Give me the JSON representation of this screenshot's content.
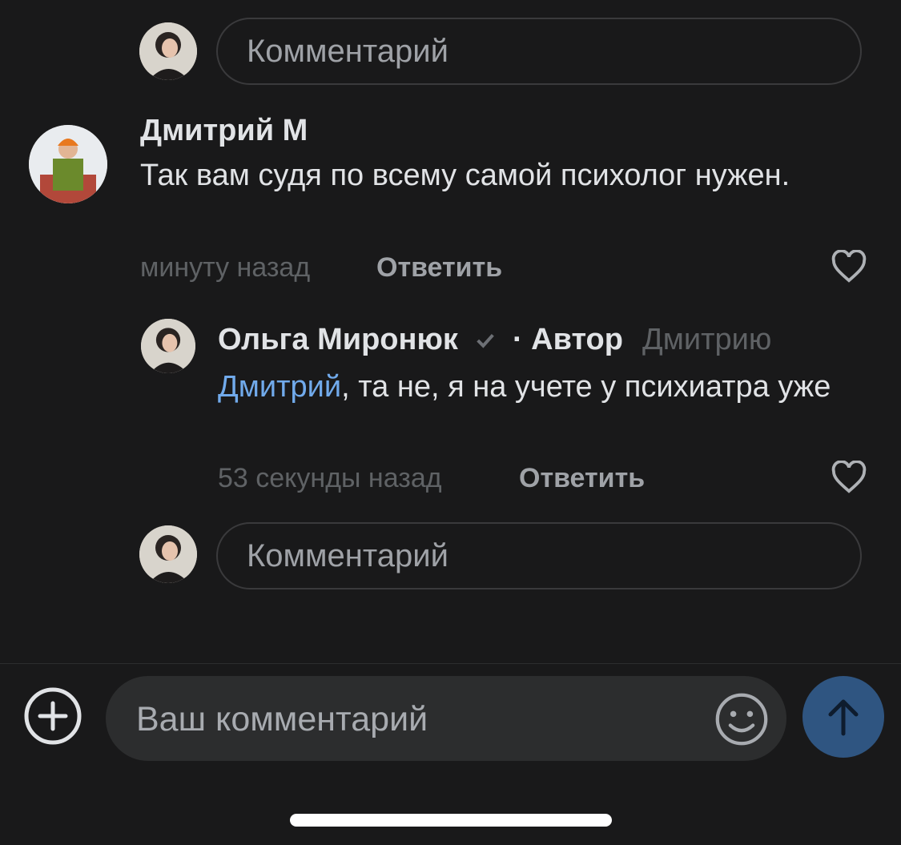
{
  "top_composer": {
    "placeholder": "Комментарий"
  },
  "comment1": {
    "author": "Дмитрий М",
    "text": "Так вам судя по всему самой психолог нужен.",
    "time": "минуту назад",
    "reply_label": "Ответить"
  },
  "reply1": {
    "author": "Ольга Миронюк",
    "author_tag": "· Автор",
    "reply_to": "Дмитрию",
    "mention": "Дмитрий",
    "text_rest": ", та не, я на учете у психиатра уже",
    "time": "53 секунды назад",
    "reply_label": "Ответить"
  },
  "thread_composer": {
    "placeholder": "Комментарий"
  },
  "bottom_bar": {
    "input_placeholder": "Ваш комментарий",
    "add_icon": "plus-circle-icon",
    "emoji_icon": "smile-icon",
    "send_icon": "arrow-up-icon"
  },
  "colors": {
    "background": "#19191a",
    "mention": "#71aaeb",
    "send_button": "#2f5581",
    "input_bg": "#2c2d2e"
  }
}
